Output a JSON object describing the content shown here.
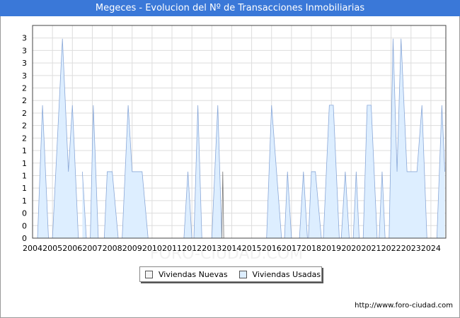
{
  "title": "Megeces - Evolucion del Nº de Transacciones Inmobiliarias",
  "footer": {
    "url": "http://www.foro-ciudad.com"
  },
  "watermark": "FORO-CIUDAD.COM",
  "colors": {
    "title_bg": "#3a78d8",
    "usadas_fill": "#ddeeff",
    "usadas_stroke": "#8aa8d8",
    "nuevas_fill": "#f4f4f4",
    "nuevas_stroke": "#777777",
    "grid": "#dddddd"
  },
  "chart_data": {
    "type": "area",
    "title": "Megeces - Evolucion del Nº de Transacciones Inmobiliarias",
    "xlabel": "",
    "ylabel": "",
    "x_tick_labels": [
      "2004",
      "2005",
      "2006",
      "2007",
      "2008",
      "2009",
      "2010",
      "2011",
      "2012",
      "2013",
      "2014",
      "2015",
      "2016",
      "2017",
      "2018",
      "2019",
      "2020",
      "2021",
      "2022",
      "2023",
      "2024"
    ],
    "y_tick_labels": [
      "0",
      "0",
      "0",
      "1",
      "1",
      "1",
      "1",
      "1",
      "2",
      "2",
      "2",
      "2",
      "2",
      "3",
      "3",
      "3",
      "3"
    ],
    "ylim": [
      0,
      3.2
    ],
    "grid": true,
    "legend_position": "bottom",
    "series": [
      {
        "name": "Viviendas Nuevas",
        "points": [
          [
            2013.5,
            0
          ],
          [
            2013.55,
            1
          ],
          [
            2013.6,
            0
          ]
        ]
      },
      {
        "name": "Viviendas Usadas",
        "points": [
          [
            2004.25,
            0
          ],
          [
            2004.5,
            2
          ],
          [
            2004.8,
            0
          ],
          [
            2005.0,
            0
          ],
          [
            2005.5,
            3
          ],
          [
            2005.8,
            1
          ],
          [
            2006.0,
            2
          ],
          [
            2006.3,
            0
          ],
          [
            2006.5,
            1
          ],
          [
            2006.7,
            0
          ],
          [
            2006.9,
            0
          ],
          [
            2007.05,
            2
          ],
          [
            2007.3,
            0
          ],
          [
            2007.6,
            0
          ],
          [
            2007.75,
            1
          ],
          [
            2008.0,
            1
          ],
          [
            2008.3,
            0
          ],
          [
            2008.5,
            0
          ],
          [
            2008.8,
            2
          ],
          [
            2009.0,
            1
          ],
          [
            2009.5,
            1
          ],
          [
            2009.8,
            0
          ],
          [
            2011.6,
            0
          ],
          [
            2011.8,
            1
          ],
          [
            2012.0,
            0
          ],
          [
            2012.1,
            0
          ],
          [
            2012.3,
            2
          ],
          [
            2012.5,
            0
          ],
          [
            2013.0,
            0
          ],
          [
            2013.3,
            2
          ],
          [
            2013.5,
            0
          ],
          [
            2015.75,
            0
          ],
          [
            2016.0,
            2
          ],
          [
            2016.5,
            0
          ],
          [
            2016.65,
            0
          ],
          [
            2016.8,
            1
          ],
          [
            2017.0,
            0
          ],
          [
            2017.4,
            0
          ],
          [
            2017.6,
            1
          ],
          [
            2017.8,
            0
          ],
          [
            2017.85,
            0
          ],
          [
            2018.0,
            1
          ],
          [
            2018.2,
            1
          ],
          [
            2018.5,
            0
          ],
          [
            2018.6,
            0
          ],
          [
            2018.9,
            2
          ],
          [
            2019.1,
            2
          ],
          [
            2019.4,
            0
          ],
          [
            2019.5,
            0
          ],
          [
            2019.7,
            1
          ],
          [
            2019.9,
            0
          ],
          [
            2020.1,
            0
          ],
          [
            2020.25,
            1
          ],
          [
            2020.4,
            0
          ],
          [
            2020.6,
            0
          ],
          [
            2020.8,
            2
          ],
          [
            2021.0,
            2
          ],
          [
            2021.3,
            0
          ],
          [
            2021.4,
            0
          ],
          [
            2021.55,
            1
          ],
          [
            2021.7,
            0
          ],
          [
            2021.9,
            0
          ],
          [
            2022.1,
            3
          ],
          [
            2022.3,
            1
          ],
          [
            2022.5,
            3
          ],
          [
            2022.8,
            1
          ],
          [
            2023.0,
            1
          ],
          [
            2023.3,
            1
          ],
          [
            2023.55,
            2
          ],
          [
            2023.8,
            0
          ],
          [
            2024.3,
            0
          ],
          [
            2024.55,
            2
          ],
          [
            2024.7,
            1
          ]
        ]
      }
    ]
  }
}
